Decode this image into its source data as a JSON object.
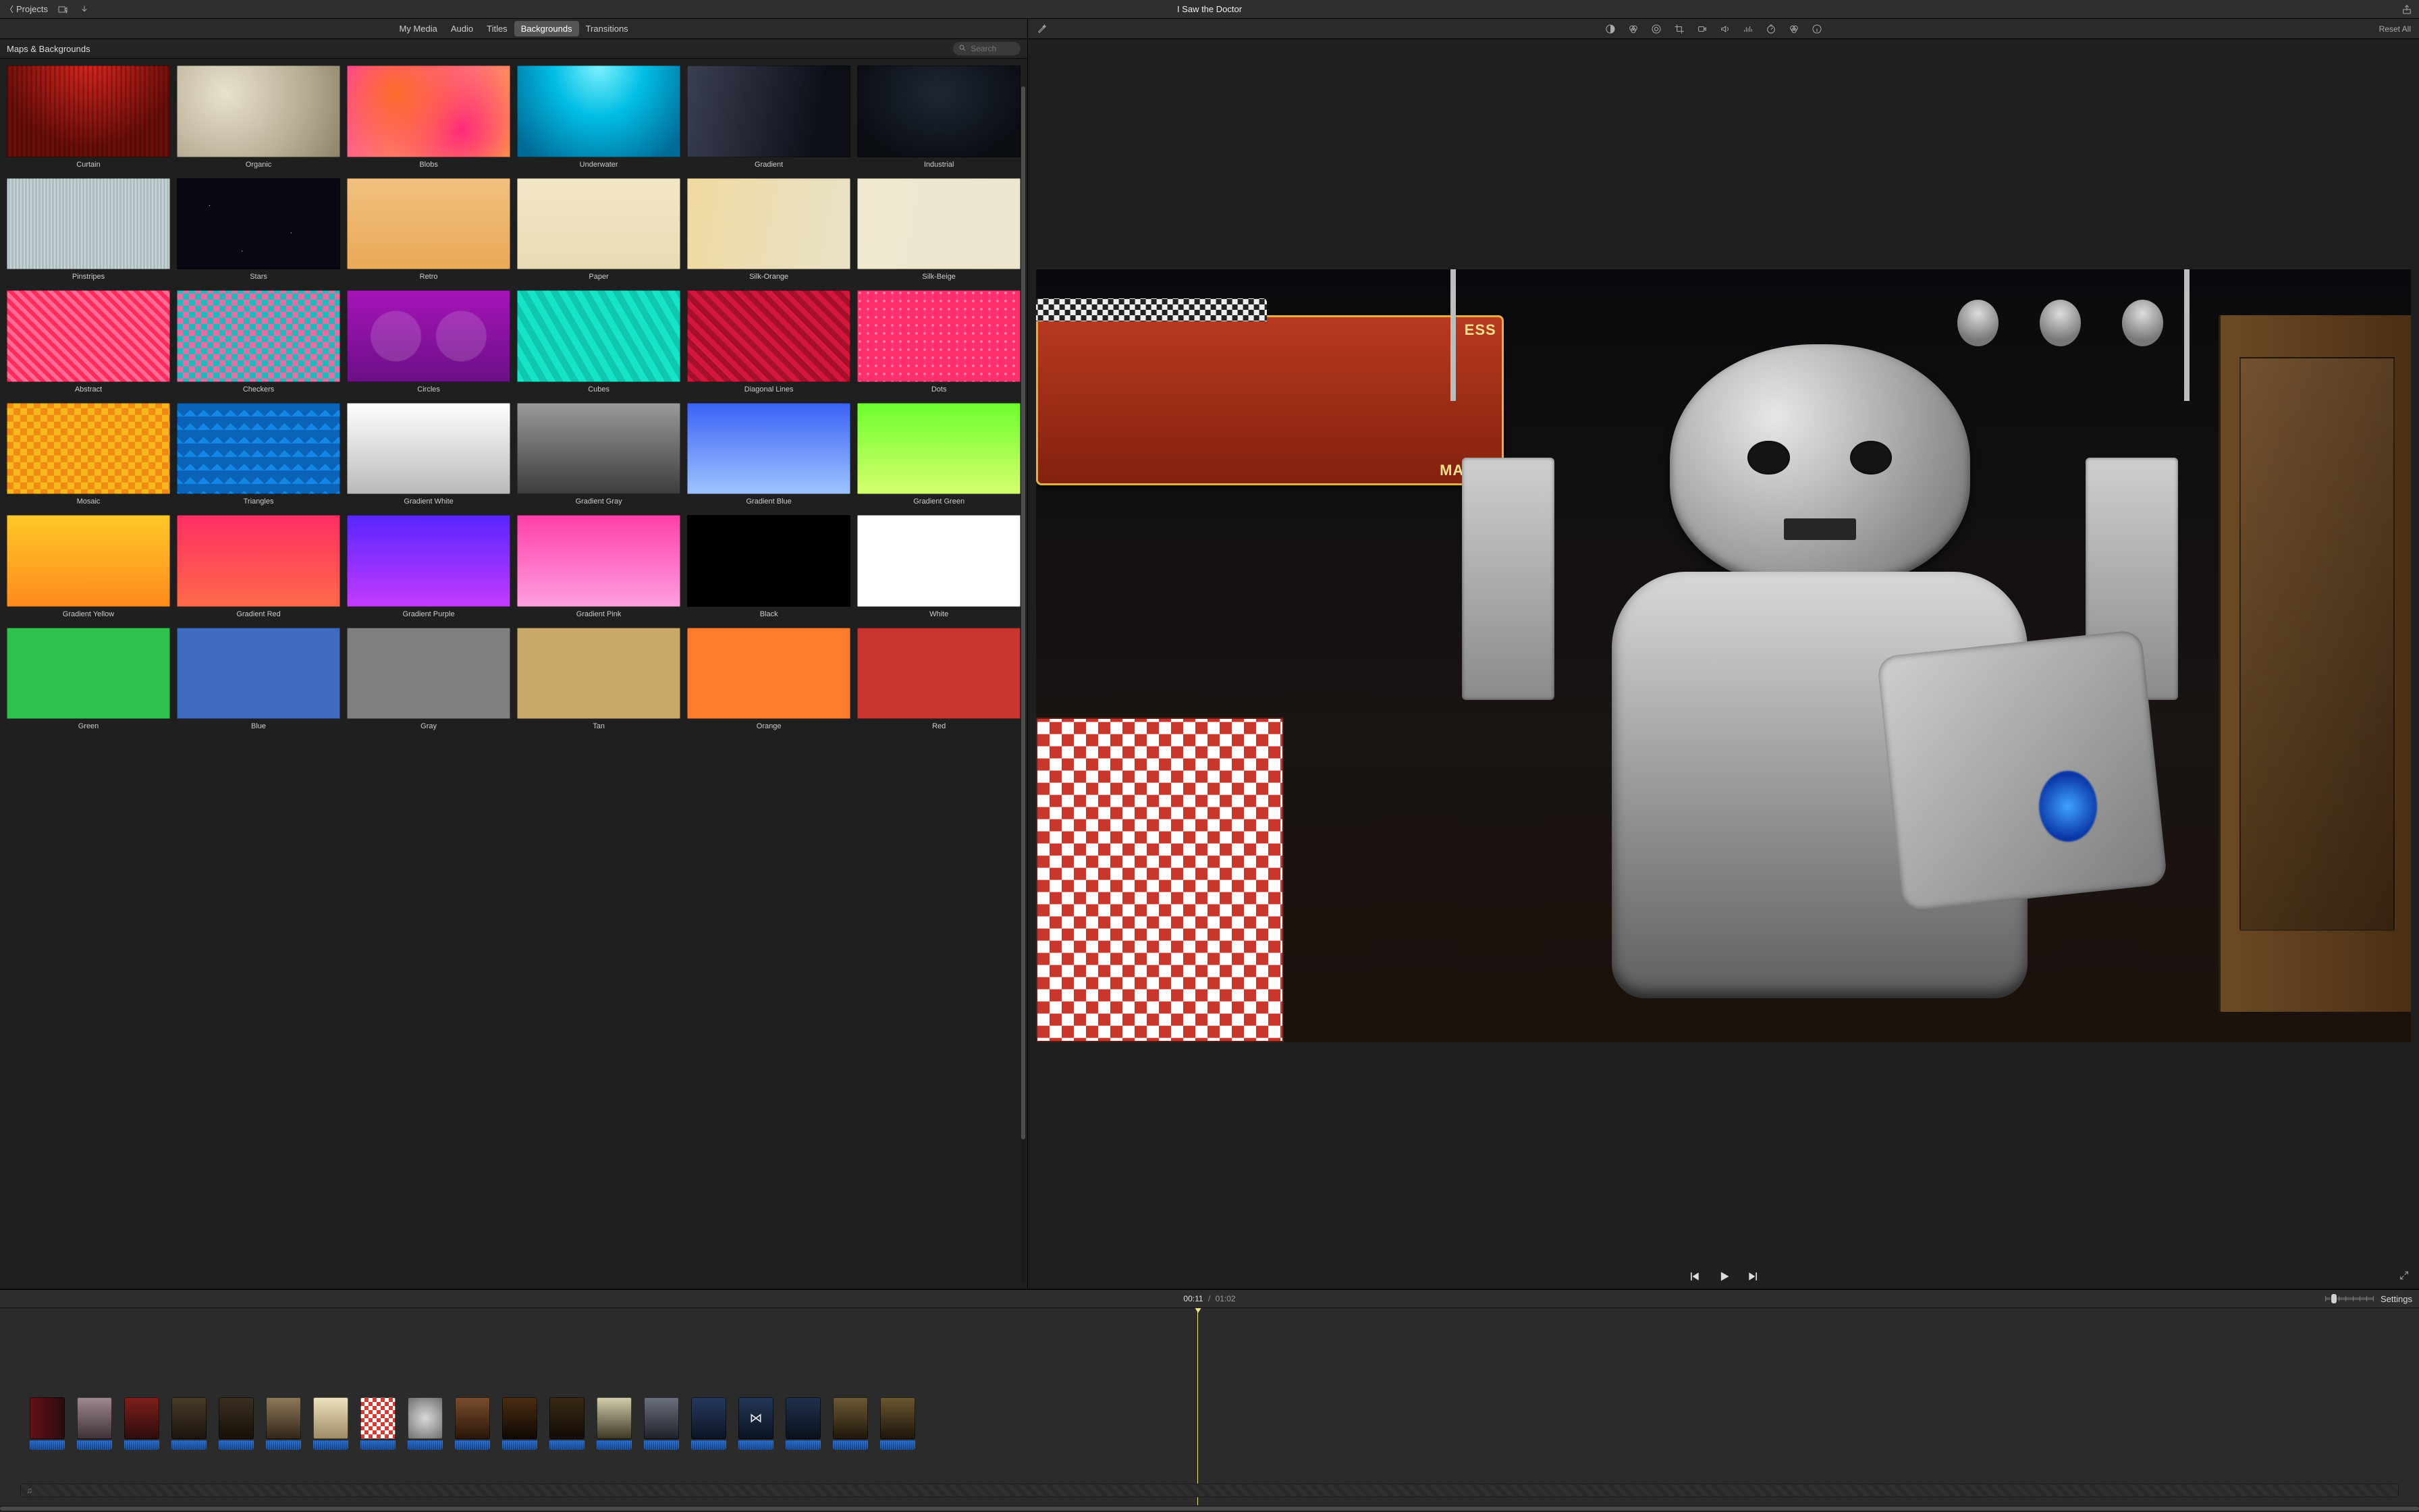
{
  "titlebar": {
    "back_label": "Projects",
    "project_title": "I Saw the Doctor"
  },
  "tabs": {
    "items": [
      "My Media",
      "Audio",
      "Titles",
      "Backgrounds",
      "Transitions"
    ],
    "active_index": 3
  },
  "browser": {
    "title": "Maps & Backgrounds",
    "search_placeholder": "Search",
    "thumbs": [
      {
        "label": "Curtain",
        "style": "background: radial-gradient(circle at 50% -10%, #e0261e, #6a0e0a 70%), repeating-linear-gradient(90deg, rgba(0,0,0,.2) 0 3px, transparent 3px 7px); background-blend-mode: multiply;"
      },
      {
        "label": "Organic",
        "style": "background: radial-gradient(circle at 30% 30%, #e7e1cf, #b7ad93 60%, #8e8369);"
      },
      {
        "label": "Blobs",
        "style": "background: radial-gradient(circle at 30% 30%, #ff6a2b, transparent 55%), radial-gradient(circle at 70% 70%, #ff2b7a, transparent 55%), linear-gradient(135deg,#ff3cac,#ffb03a);"
      },
      {
        "label": "Underwater",
        "style": "background: radial-gradient(ellipse at 50% 0%, #7ef2ff, #00bde3 40%, #006a97 90%);"
      },
      {
        "label": "Gradient",
        "style": "background: linear-gradient(100deg, #3a3f52 0%, #0d0f17 80%);"
      },
      {
        "label": "Industrial",
        "style": "background: radial-gradient(ellipse at 50% 30%, #1e2733, #0a0d12 80%);"
      },
      {
        "label": "Pinstripes",
        "style": "background: repeating-linear-gradient(90deg, #c7d3d4 0 2px, #aebdbf 2px 5px);"
      },
      {
        "label": "Stars",
        "style": "background: radial-gradient(1px 1px at 20% 30%, #fff, transparent), radial-gradient(1px 1px at 70% 60%, #fff, transparent), radial-gradient(1px 1px at 40% 80%, #fff, transparent), #070812;"
      },
      {
        "label": "Retro",
        "style": "background: linear-gradient(#f2c080,#e9a957);"
      },
      {
        "label": "Paper",
        "style": "background: linear-gradient(#f2e6c8,#e9dcb4);"
      },
      {
        "label": "Silk-Orange",
        "style": "background: linear-gradient(100deg,#f0d9a0,#e9e2c8);"
      },
      {
        "label": "Silk-Beige",
        "style": "background: linear-gradient(100deg,#efe8cf,#ece6cf);"
      },
      {
        "label": "Abstract",
        "style": "background: repeating-linear-gradient(45deg,#ff2b5e 0 6px,#ff6b95 6px 12px), repeating-linear-gradient(-45deg, rgba(255,255,255,.2) 0 4px, transparent 4px 8px);"
      },
      {
        "label": "Checkers",
        "style": "background: repeating-conic-gradient(#1fb9bd 0 25%, #e76ea2 0 50%) 0/18px 18px;"
      },
      {
        "label": "Circles",
        "style": "background: radial-gradient(circle at 30% 50%, rgba(255,255,255,.15) 20%, transparent 21%), radial-gradient(circle at 70% 50%, rgba(255,255,255,.15) 20%, transparent 21%), linear-gradient(#a514b8,#6c0f87);"
      },
      {
        "label": "Cubes",
        "style": "background: repeating-linear-gradient(60deg,#16e3c8 0 10px,#0fc7af 10px 20px), repeating-linear-gradient(-60deg, rgba(0,0,0,.08) 0 10px, transparent 10px 20px);"
      },
      {
        "label": "Diagonal Lines",
        "style": "background: repeating-linear-gradient(45deg,#d4183d 0 8px,#a50f2c 8px 16px);"
      },
      {
        "label": "Dots",
        "style": "background: radial-gradient(circle at 4px 4px, rgba(255,255,255,.35) 2px, transparent 2px) 0 0/12px 12px, #ff2f6e;"
      },
      {
        "label": "Mosaic",
        "style": "background: repeating-conic-gradient(#f6b81d 0 25%, #f08a12 0 50%) 0/20px 20px;"
      },
      {
        "label": "Triangles",
        "style": "background: linear-gradient(45deg,#1387e6 25%, transparent 25%) 0 0/20px 20px, linear-gradient(-45deg,#1387e6 25%, transparent 25%) 0 0/20px 20px, #0a63b8;"
      },
      {
        "label": "Gradient White",
        "style": "background: linear-gradient(#fff,#b9b9b9);"
      },
      {
        "label": "Gradient Gray",
        "style": "background: linear-gradient(#9a9a9a,#3d3d3d);"
      },
      {
        "label": "Gradient Blue",
        "style": "background: linear-gradient(#3a63f5,#9fc3ff);"
      },
      {
        "label": "Gradient Green",
        "style": "background: linear-gradient(#6dff2d,#d6ff6e);"
      },
      {
        "label": "Gradient Yellow",
        "style": "background: linear-gradient(#ffc928,#ff8a1e);"
      },
      {
        "label": "Gradient Red",
        "style": "background: linear-gradient(#ff2e63,#ff6a49);"
      },
      {
        "label": "Gradient Purple",
        "style": "background: linear-gradient(#5726ff,#c53bff);"
      },
      {
        "label": "Gradient Pink",
        "style": "background: linear-gradient(#ff3fa8,#ff9fe0);"
      },
      {
        "label": "Black",
        "style": "background: #000000;"
      },
      {
        "label": "White",
        "style": "background: #ffffff;"
      },
      {
        "label": "Green",
        "style": "background: #2fontc24d; background:#2fc24d;"
      },
      {
        "label": "Blue",
        "style": "background: #3f6bbf;"
      },
      {
        "label": "Gray",
        "style": "background: #808080;"
      },
      {
        "label": "Tan",
        "style": "background: #c9a86a;"
      },
      {
        "label": "Orange",
        "style": "background: #ff7b2e;"
      },
      {
        "label": "Red",
        "style": "background: #c8342e;"
      }
    ]
  },
  "viewer": {
    "reset_all_label": "Reset All",
    "sign_line1": "ESS",
    "sign_line2": "MATON",
    "tools": [
      "enhance-icon",
      "color-balance-icon",
      "color-correction-icon",
      "crop-icon",
      "stabilize-icon",
      "volume-icon",
      "noise-reduction-icon",
      "speed-icon",
      "filters-icon",
      "info-icon"
    ]
  },
  "timebar": {
    "current": "00:11",
    "separator": "/",
    "total": "01:02",
    "settings_label": "Settings"
  },
  "timeline": {
    "playhead_percent": 49.5,
    "music_icon": "♫",
    "clips": [
      {
        "style": "background: linear-gradient(90deg,#651017,#2a0c11);"
      },
      {
        "style": "background: linear-gradient(#9f8a90,#3e3038);"
      },
      {
        "style": "background: linear-gradient(#7f1f1c,#2c0c0b);"
      },
      {
        "style": "background: linear-gradient(#4a3b2a,#1b140d);"
      },
      {
        "style": "background: linear-gradient(#3a2f20,#171008);"
      },
      {
        "style": "background: linear-gradient(#8f795a,#322618);"
      },
      {
        "style": "background: linear-gradient(#efe4c0,#9c8a62);"
      },
      {
        "style": "background: repeating-conic-gradient(#d23c34 0 25%, #fff 0 50%) 0/12px 12px;"
      },
      {
        "style": "background: radial-gradient(circle,#d9d9d9,#6b6b6b);"
      },
      {
        "style": "background: linear-gradient(#7a4e2e,#2a1509);"
      },
      {
        "style": "background: linear-gradient(#4a2e12,#0f0803);"
      },
      {
        "style": "background: linear-gradient(#3a2a15,#120b05);"
      },
      {
        "style": "background: linear-gradient(#d4cfae,#3a3622);"
      },
      {
        "style": "background: linear-gradient(#6b717d,#1d2028);"
      },
      {
        "style": "background: linear-gradient(#263a5e,#0b1424);"
      },
      {
        "style": "background: linear-gradient(#243656,#0a1220);",
        "transition": true
      },
      {
        "style": "background: linear-gradient(#21314c,#0a101c);"
      },
      {
        "style": "background: linear-gradient(#6c5a36,#1f170b);"
      },
      {
        "style": "background: linear-gradient(#6a5732,#1d150a);"
      }
    ]
  }
}
